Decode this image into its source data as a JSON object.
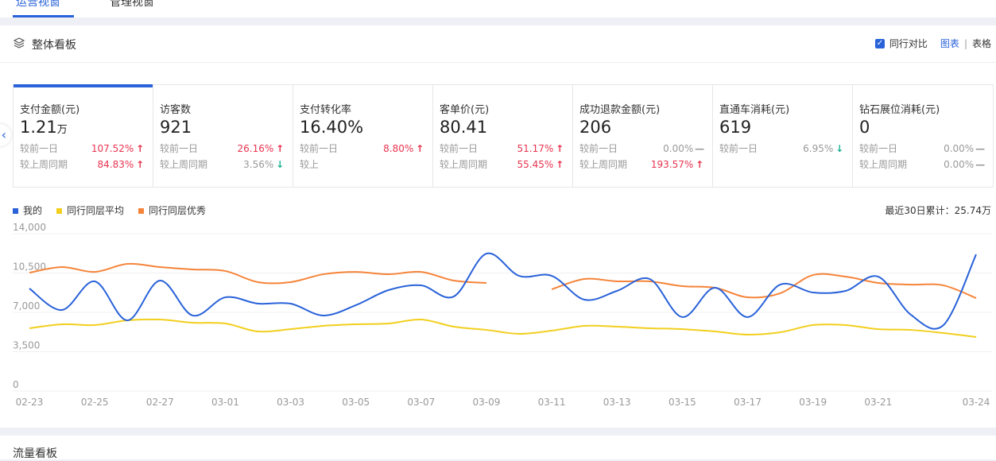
{
  "tabs": [
    {
      "label": "运营视窗"
    },
    {
      "label": "管理视窗"
    }
  ],
  "panel": {
    "title": "整体看板",
    "compare_label": "同行对比",
    "chart_link": "图表",
    "table_link": "表格",
    "separator": "|"
  },
  "cards": [
    {
      "title": "支付金额(元)",
      "value": "1.21",
      "unit": "万",
      "rows": [
        {
          "label": "较前一日",
          "value": "107.52%",
          "trend": "up"
        },
        {
          "label": "较上周同期",
          "value": "84.83%",
          "trend": "up"
        }
      ]
    },
    {
      "title": "访客数",
      "value": "921",
      "unit": "",
      "rows": [
        {
          "label": "较前一日",
          "value": "26.16%",
          "trend": "up"
        },
        {
          "label": "较上周同期",
          "value": "3.56%",
          "trend": "down"
        }
      ]
    },
    {
      "title": "支付转化率",
      "value": "16.40%",
      "unit": "",
      "rows": [
        {
          "label": "较前一日",
          "value": "8.80%",
          "trend": "up"
        },
        {
          "label": "较上",
          "value": "",
          "trend": ""
        }
      ]
    },
    {
      "title": "客单价(元)",
      "value": "80.41",
      "unit": "",
      "rows": [
        {
          "label": "较前一日",
          "value": "51.17%",
          "trend": "up"
        },
        {
          "label": "较上周同期",
          "value": "55.45%",
          "trend": "up"
        }
      ]
    },
    {
      "title": "成功退款金额(元)",
      "value": "206",
      "unit": "",
      "rows": [
        {
          "label": "较前一日",
          "value": "0.00%",
          "trend": "flat"
        },
        {
          "label": "较上周同期",
          "value": "193.57%",
          "trend": "up"
        }
      ]
    },
    {
      "title": "直通车消耗(元)",
      "value": "619",
      "unit": "",
      "rows": [
        {
          "label": "较前一日",
          "value": "6.95%",
          "trend": "down"
        }
      ]
    },
    {
      "title": "钻石展位消耗(元)",
      "value": "0",
      "unit": "",
      "rows": [
        {
          "label": "较前一日",
          "value": "0.00%",
          "trend": "flat"
        },
        {
          "label": "较上周同期",
          "value": "0.00%",
          "trend": "flat"
        }
      ]
    }
  ],
  "total_label": "最近30日累计：25.74万",
  "section2_title": "流量看板",
  "chart_data": {
    "type": "line",
    "title": "",
    "xlabel": "",
    "ylabel": "",
    "ylim": [
      0,
      14000
    ],
    "yticks": [
      "0",
      "3,500",
      "7,000",
      "10,500",
      "14,000"
    ],
    "ytick_values": [
      0,
      3500,
      7000,
      10500,
      14000
    ],
    "x": [
      "02-23",
      "02-24",
      "02-25",
      "02-26",
      "02-27",
      "02-28",
      "03-01",
      "03-02",
      "03-03",
      "03-04",
      "03-05",
      "03-06",
      "03-07",
      "03-08",
      "03-09",
      "03-10",
      "03-11",
      "03-12",
      "03-13",
      "03-14",
      "03-15",
      "03-16",
      "03-17",
      "03-18",
      "03-19",
      "03-20",
      "03-21",
      "03-22",
      "03-23",
      "03-24"
    ],
    "xtick_labels": [
      "02-23",
      "02-25",
      "02-27",
      "03-01",
      "03-03",
      "03-05",
      "03-07",
      "03-09",
      "03-11",
      "03-13",
      "03-15",
      "03-17",
      "03-19",
      "03-21",
      "03-24"
    ],
    "legend_position": "top-left",
    "grid": true,
    "series": [
      {
        "name": "我的",
        "color": "#2962d9",
        "values": [
          9120,
          7210,
          9760,
          6290,
          9830,
          6720,
          8340,
          7780,
          7780,
          6720,
          7640,
          8980,
          9400,
          8410,
          12230,
          10250,
          10250,
          8130,
          8910,
          9970,
          6580,
          9190,
          6580,
          9470,
          8770,
          8910,
          10180,
          6790,
          5870,
          12160
        ]
      },
      {
        "name": "同行同层平均",
        "color": "#f2cf1f",
        "values": [
          5590,
          5940,
          5870,
          6290,
          6360,
          6080,
          6010,
          5300,
          5510,
          5800,
          5940,
          6010,
          6360,
          5730,
          5440,
          5090,
          5370,
          5800,
          5730,
          5590,
          5510,
          5300,
          5020,
          5230,
          5870,
          5870,
          5510,
          5440,
          5160,
          4810
        ]
      },
      {
        "name": "同行同层优秀",
        "color": "#f5843a",
        "values": [
          10530,
          11030,
          10600,
          11310,
          11030,
          10820,
          10680,
          9690,
          9690,
          10390,
          10600,
          10390,
          10600,
          9830,
          9620,
          null,
          9050,
          9970,
          9760,
          9760,
          9330,
          9190,
          8340,
          8700,
          10320,
          10180,
          9620,
          9470,
          9400,
          8270
        ]
      }
    ]
  }
}
